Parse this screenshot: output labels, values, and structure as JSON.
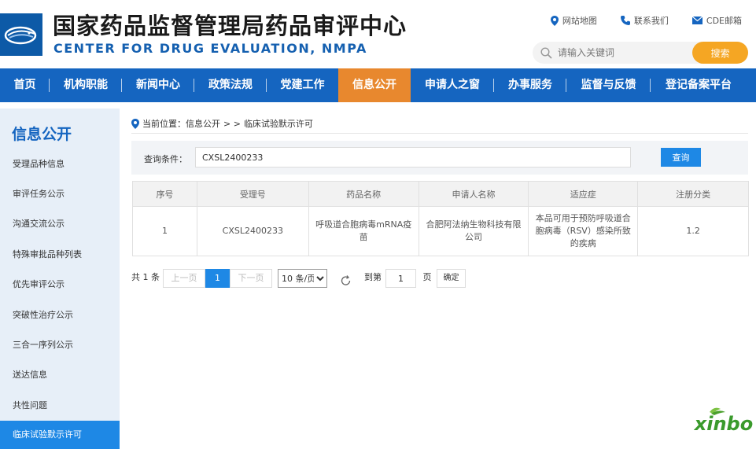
{
  "header": {
    "title_cn": "国家药品监督管理局药品审评中心",
    "title_en": "CENTER FOR DRUG EVALUATION, NMPA",
    "links": [
      "网站地图",
      "联系我们",
      "CDE邮箱"
    ],
    "search_placeholder": "请输入关键词",
    "search_button": "搜索"
  },
  "nav": {
    "items": [
      "首页",
      "机构职能",
      "新闻中心",
      "政策法规",
      "党建工作",
      "信息公开",
      "申请人之窗",
      "办事服务",
      "监督与反馈",
      "登记备案平台"
    ],
    "active": "信息公开"
  },
  "sidebar": {
    "title": "信息公开",
    "items": [
      "受理品种信息",
      "审评任务公示",
      "沟通交流公示",
      "特殊审批品种列表",
      "优先审评公示",
      "突破性治疗公示",
      "三合一序列公示",
      "送达信息",
      "共性问题",
      "临床试验默示许可"
    ],
    "active": "临床试验默示许可"
  },
  "breadcrumb": {
    "prefix": "当前位置：信息公开",
    "arrows": "> >",
    "current": "临床试验默示许可"
  },
  "query": {
    "label": "查询条件：",
    "value": "CXSL2400233",
    "button": "查询"
  },
  "table": {
    "headers": [
      "序号",
      "受理号",
      "药品名称",
      "申请人名称",
      "适应症",
      "注册分类"
    ],
    "rows": [
      [
        "1",
        "CXSL2400233",
        "呼吸道合胞病毒mRNA疫苗",
        "合肥阿法纳生物科技有限公司",
        "本品可用于预防呼吸道合胞病毒（RSV）感染所致的疾病",
        "1.2"
      ]
    ]
  },
  "pager": {
    "total": "共 1 条",
    "prev": "上一页",
    "current": "1",
    "next": "下一页",
    "page_size": "10 条/页",
    "goto_label": "到第",
    "goto_value": "1",
    "page_unit": "页",
    "confirm": "确定"
  },
  "watermark": "xinbo",
  "colors": {
    "primary": "#1565c0",
    "accent": "#e8882e",
    "button_blue": "#1e88e5",
    "search_orange": "#f5a623",
    "sidebar_bg": "#e7eff8"
  }
}
